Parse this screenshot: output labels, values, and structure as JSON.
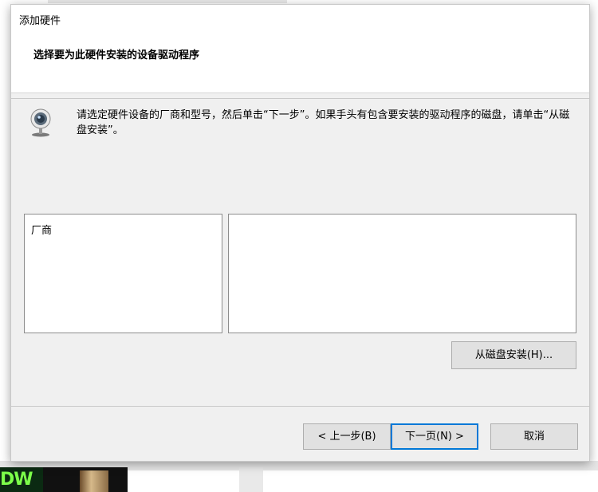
{
  "dialog": {
    "title": "添加硬件",
    "subtitle": "选择要为此硬件安装的设备驱动程序",
    "instruction": "请选定硬件设备的厂商和型号，然后单击“下一步”。如果手头有包含要安装的驱动程序的磁盘，请单击“从磁盘安装”。",
    "icon": "webcam-icon"
  },
  "lists": {
    "manufacturer_header": "厂商",
    "model_header": ""
  },
  "buttons": {
    "have_disk": "从磁盘安装(H)...",
    "back": "< 上一步(B)",
    "next": "下一页(N) >",
    "cancel": "取消"
  },
  "colors": {
    "accent": "#0078d7",
    "dialog_bg": "#f0f0f0"
  }
}
